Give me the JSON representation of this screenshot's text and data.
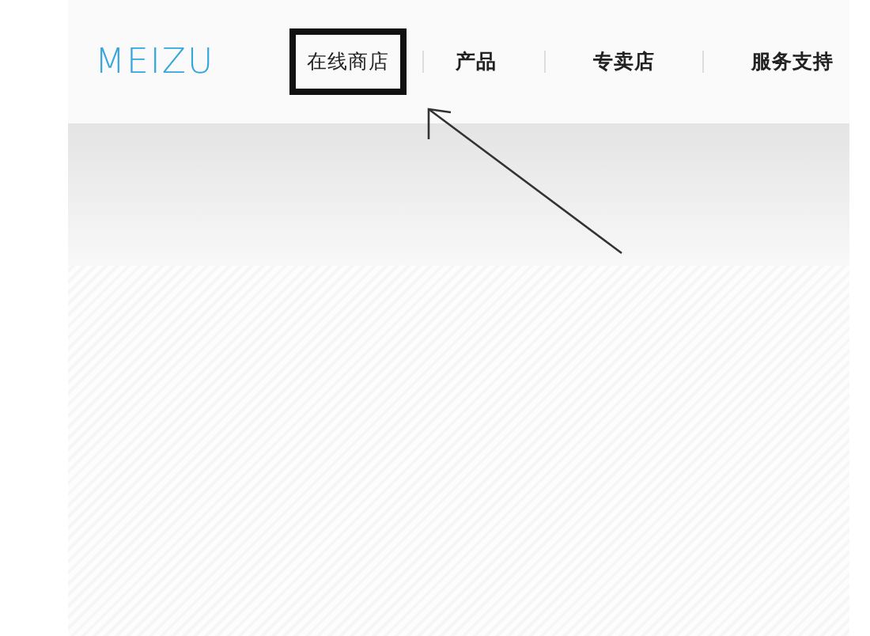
{
  "logo": {
    "text": "MEIZU"
  },
  "nav": [
    {
      "label": "在线商店",
      "highlighted": true
    },
    {
      "label": "产品",
      "highlighted": false
    },
    {
      "label": "专卖店",
      "highlighted": false
    },
    {
      "label": "服务支持",
      "highlighted": false
    }
  ],
  "annotation": {
    "kind": "arrow"
  }
}
